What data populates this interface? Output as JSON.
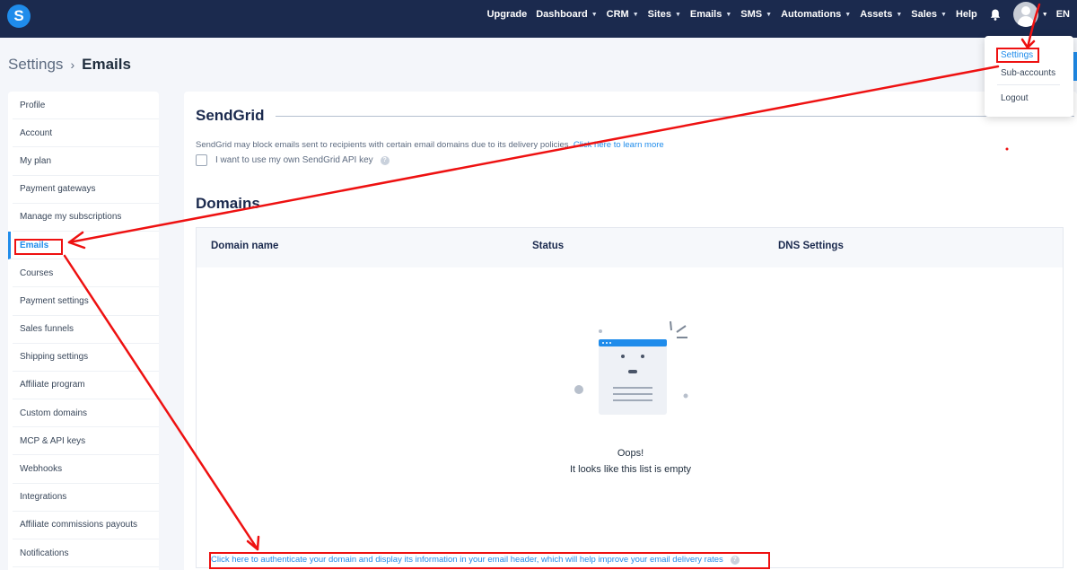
{
  "brand": {
    "logo_letter": "S",
    "accent": "#1f8ceb",
    "nav_bg": "#1b2a4e",
    "annotation_color": "#ee1111"
  },
  "nav": {
    "items": [
      {
        "label": "Upgrade",
        "dropdown": false
      },
      {
        "label": "Dashboard",
        "dropdown": true
      },
      {
        "label": "CRM",
        "dropdown": true
      },
      {
        "label": "Sites",
        "dropdown": true
      },
      {
        "label": "Emails",
        "dropdown": true
      },
      {
        "label": "SMS",
        "dropdown": true
      },
      {
        "label": "Automations",
        "dropdown": true
      },
      {
        "label": "Assets",
        "dropdown": true
      },
      {
        "label": "Sales",
        "dropdown": true
      },
      {
        "label": "Help",
        "dropdown": false
      }
    ],
    "caret": "▼",
    "language": "EN"
  },
  "breadcrumb": {
    "parent": "Settings",
    "separator": "›",
    "current": "Emails"
  },
  "sidebar": {
    "items": [
      {
        "label": "Profile"
      },
      {
        "label": "Account"
      },
      {
        "label": "My plan"
      },
      {
        "label": "Payment gateways"
      },
      {
        "label": "Manage my subscriptions"
      },
      {
        "label": "Emails",
        "active": true
      },
      {
        "label": "Courses"
      },
      {
        "label": "Payment settings"
      },
      {
        "label": "Sales funnels"
      },
      {
        "label": "Shipping settings"
      },
      {
        "label": "Affiliate program"
      },
      {
        "label": "Custom domains"
      },
      {
        "label": "MCP & API keys"
      },
      {
        "label": "Webhooks"
      },
      {
        "label": "Integrations"
      },
      {
        "label": "Affiliate commissions payouts"
      },
      {
        "label": "Notifications"
      }
    ]
  },
  "sendgrid": {
    "title": "SendGrid",
    "description": "SendGrid may block emails sent to recipients with certain email domains due to its delivery policies. ",
    "learn_more": "Click here to learn more",
    "checkbox_label": "I want to use my own SendGrid API key",
    "help": "?"
  },
  "domains": {
    "title": "Domains",
    "columns": [
      "Domain name",
      "Status",
      "DNS Settings"
    ],
    "empty_title": "Oops!",
    "empty_subtitle": "It looks like this list is empty",
    "auth_link": "Click here to authenticate your domain and display its information in your email header, which will help improve your email delivery rates",
    "help": "?"
  },
  "account_menu": {
    "items": [
      "Settings",
      "Sub-accounts",
      "Logout"
    ]
  }
}
